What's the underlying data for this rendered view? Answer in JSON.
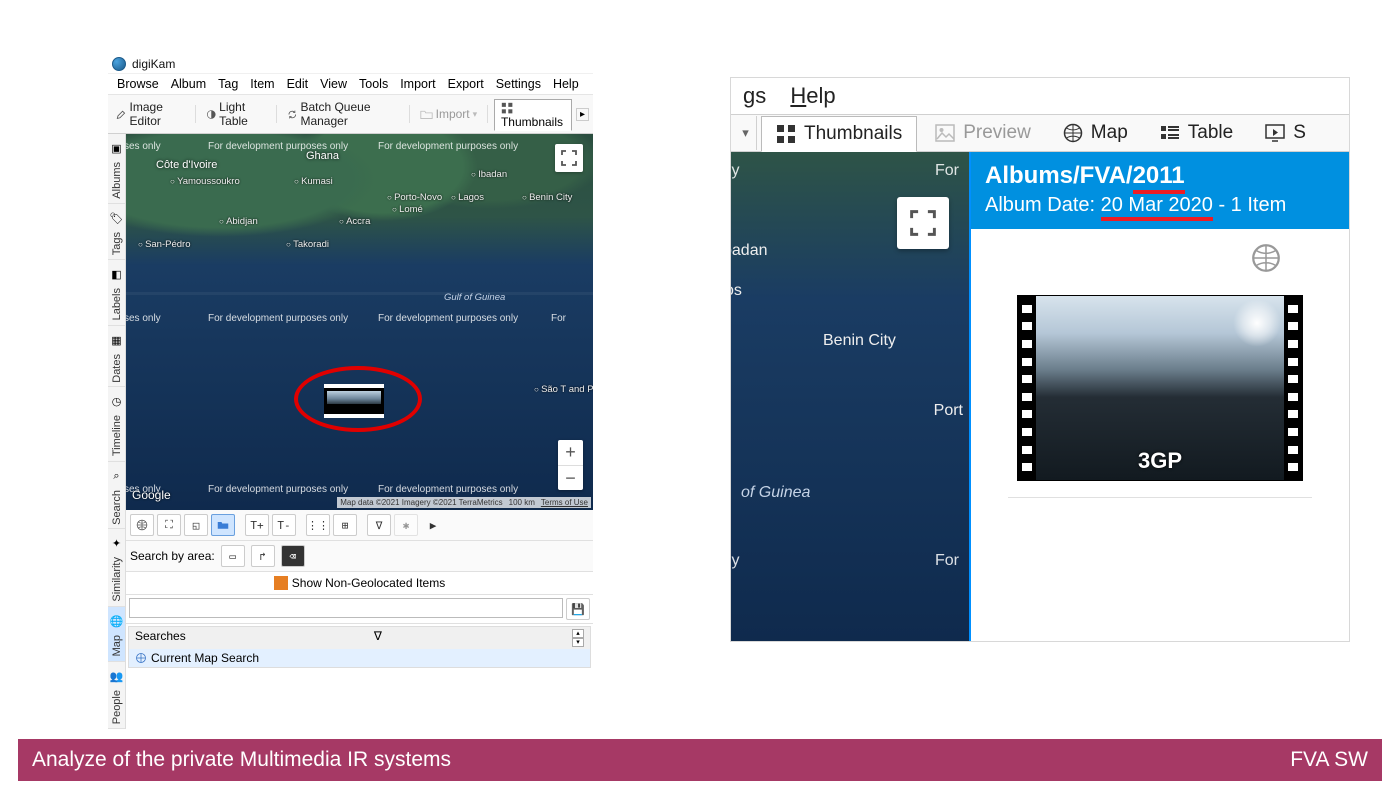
{
  "app": {
    "title": "digiKam"
  },
  "menubar": [
    "Browse",
    "Album",
    "Tag",
    "Item",
    "Edit",
    "View",
    "Tools",
    "Import",
    "Export",
    "Settings",
    "Help"
  ],
  "toolbar": {
    "image_editor": "Image Editor",
    "light_table": "Light Table",
    "batch_queue": "Batch Queue Manager",
    "import": "Import",
    "thumbnails": "Thumbnails"
  },
  "sidetabs": [
    "Albums",
    "Tags",
    "Labels",
    "Dates",
    "Timeline",
    "Search",
    "Similarity",
    "Map",
    "People"
  ],
  "sidetabs_selected": "Map",
  "map": {
    "watermark": "For development purposes only",
    "countries": [
      "Côte d'Ivoire",
      "Ghana"
    ],
    "cities": [
      "Yamoussoukro",
      "Kumasi",
      "Abidjan",
      "Accra",
      "Ibadan",
      "Lagos",
      "Porto-Novo",
      "Lomé",
      "Benin City",
      "San-Pédro",
      "Takoradi",
      "São T and Prí"
    ],
    "gulf": "Gulf of Guinea",
    "logo": "Google",
    "attribution": [
      "Map data ©2021  Imagery ©2021 TerraMetrics",
      "100 km",
      "Terms of Use"
    ],
    "zoom_in": "+",
    "zoom_out": "−"
  },
  "maptoolbar": {
    "t_plus": "T+",
    "t_minus": "T-"
  },
  "search_area": {
    "label": "Search by area:"
  },
  "show_non_geo": "Show Non-Geolocated Items",
  "saved": {
    "header": "Searches",
    "current": "Current Map Search"
  },
  "right": {
    "menu_gs": "gs",
    "menu_help": "Help",
    "tabs": {
      "thumbnails": "Thumbnails",
      "preview": "Preview",
      "map": "Map",
      "table": "Table",
      "s": "S"
    },
    "map": {
      "cities": [
        "badan",
        "Benin City",
        "Port"
      ],
      "gulf": "of Guinea",
      "poses_only": "poses only",
      "for": "For",
      "os": "os"
    },
    "album": {
      "path": "Albums/FVA/2011",
      "path_highlight": "2011",
      "date_prefix": "Album Date: ",
      "date_highlight": "20 Mar 2020",
      "date_suffix": " - 1 Item"
    },
    "thumb_format": "3GP"
  },
  "footer": {
    "left": "Analyze of the private Multimedia IR systems",
    "right": "FVA SW"
  }
}
